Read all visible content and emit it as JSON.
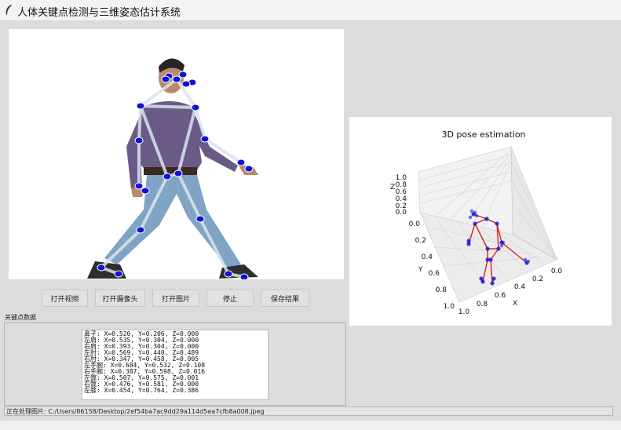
{
  "window": {
    "title": "人体关键点检测与三维姿态估计系统"
  },
  "buttons": [
    {
      "label": "打开视频"
    },
    {
      "label": "打开摄像头"
    },
    {
      "label": "打开图片"
    },
    {
      "label": "停止"
    },
    {
      "label": "保存结果"
    }
  ],
  "keypoints_panel": {
    "label": "关键点数据",
    "lines": [
      "鼻子: X=0.520, Y=0.206, Z=0.000",
      "左肩: X=0.535, Y=0.304, Z=0.000",
      "右肩: X=0.393, Y=0.304, Z=0.000",
      "左肘: X=0.569, Y=0.440, Z=0.489",
      "右肘: X=0.347, Y=0.458, Z=0.005",
      "左手腕: X=0.684, Y=0.532, Z=0.108",
      "右手腕: X=0.387, Y=0.598, Z=0.016",
      "左髋: X=0.507, Y=0.575, Z=0.001",
      "右髋: X=0.476, Y=0.581, Z=0.000",
      "左膝: X=0.454, Y=0.764, Z=0.386"
    ]
  },
  "plot": {
    "title": "3D pose estimation",
    "z_label": "Z",
    "y_label": "Y",
    "x_label": "X",
    "z_ticks": [
      "1.0",
      "0.8",
      "0.6",
      "0.4",
      "0.2",
      "0.0"
    ],
    "y_ticks": [
      "0.0",
      "0.2",
      "0.4",
      "0.6",
      "0.8",
      "1.0"
    ],
    "x_ticks": [
      "1.0",
      "0.8",
      "0.6",
      "0.4",
      "0.2",
      "0.0"
    ]
  },
  "status": {
    "text": "正在处理图片: C:/Users/86158/Desktop/2ef54ba7ac9dd29a114d5ea7cfb8a008.jpeg"
  },
  "colors": {
    "keypoint": "#1010d8",
    "skeleton_2d": "#d8e4ee",
    "skeleton_3d": "#d42020"
  }
}
